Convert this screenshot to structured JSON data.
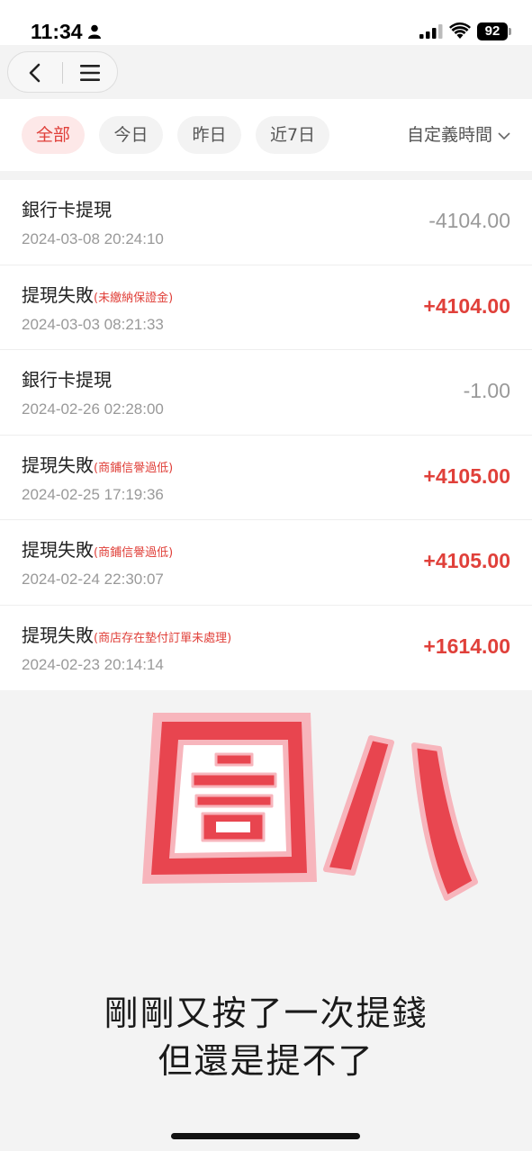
{
  "status_bar": {
    "time": "11:34",
    "battery": "92"
  },
  "filters": {
    "chips": [
      "全部",
      "今日",
      "昨日",
      "近7日"
    ],
    "custom_time": "自定義時間"
  },
  "transactions": [
    {
      "title": "銀行卡提現",
      "reason": "",
      "date": "2024-03-08 20:24:10",
      "amount": "-4104.00",
      "type": "debit"
    },
    {
      "title": "提現失敗",
      "reason": "(未繳納保證金)",
      "date": "2024-03-03 08:21:33",
      "amount": "+4104.00",
      "type": "credit"
    },
    {
      "title": "銀行卡提現",
      "reason": "",
      "date": "2024-02-26 02:28:00",
      "amount": "-1.00",
      "type": "debit"
    },
    {
      "title": "提現失敗",
      "reason": "(商鋪信譽過低)",
      "date": "2024-02-25 17:19:36",
      "amount": "+4105.00",
      "type": "credit"
    },
    {
      "title": "提現失敗",
      "reason": "(商鋪信譽過低)",
      "date": "2024-02-24 22:30:07",
      "amount": "+4105.00",
      "type": "credit"
    },
    {
      "title": "提現失敗",
      "reason": "(商店存在墊付訂單未處理)",
      "date": "2024-02-23 20:14:14",
      "amount": "+1614.00",
      "type": "credit"
    }
  ],
  "overlay": {
    "stamp_text": "圖八",
    "caption_line1": "剛剛又按了一次提錢",
    "caption_line2": "但還是提不了"
  },
  "colors": {
    "accent_red": "#e0403a",
    "stamp_red": "#e8454f",
    "stamp_outline": "#f7b5bc"
  }
}
